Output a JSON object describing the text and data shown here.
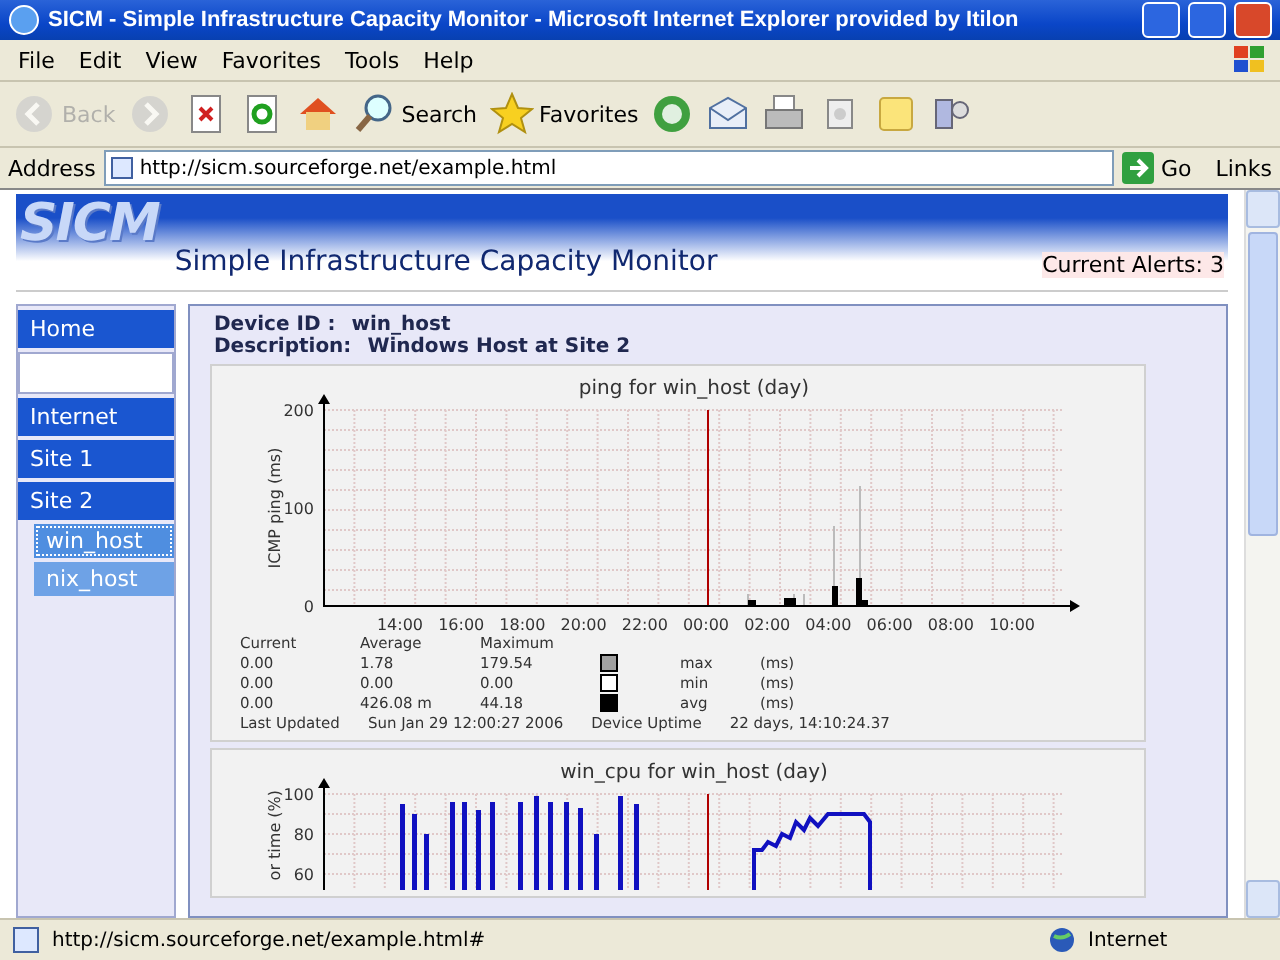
{
  "window": {
    "title": "SICM - Simple Infrastructure Capacity Monitor - Microsoft Internet Explorer provided by Itilon"
  },
  "menu": [
    "File",
    "Edit",
    "View",
    "Favorites",
    "Tools",
    "Help"
  ],
  "toolbar": [
    {
      "kind": "back",
      "label": "Back",
      "disabled": true
    },
    {
      "kind": "forward",
      "disabled": true
    },
    {
      "kind": "stop"
    },
    {
      "kind": "refresh"
    },
    {
      "kind": "home"
    },
    {
      "kind": "search",
      "label": "Search"
    },
    {
      "kind": "favorites",
      "label": "Favorites"
    },
    {
      "kind": "media"
    },
    {
      "kind": "mail"
    },
    {
      "kind": "print"
    },
    {
      "kind": "edit"
    },
    {
      "kind": "note"
    },
    {
      "kind": "messenger"
    }
  ],
  "address": {
    "label": "Address",
    "value": "http://sicm.sourceforge.net/example.html",
    "go": "Go",
    "links": "Links"
  },
  "header": {
    "logo": "SICM",
    "title": "Simple Infrastructure Capacity Monitor",
    "alerts": "Current Alerts: 3"
  },
  "sidebar": {
    "items": [
      {
        "kind": "link",
        "label": "Home",
        "selected": false
      },
      {
        "kind": "blank"
      },
      {
        "kind": "link",
        "label": "Internet",
        "selected": false
      },
      {
        "kind": "link",
        "label": "Site 1",
        "selected": false
      },
      {
        "kind": "link",
        "label": "Site 2",
        "selected": false,
        "children": [
          {
            "label": "win_host",
            "selected": true
          },
          {
            "label": "nix_host",
            "selected": false
          }
        ]
      }
    ]
  },
  "device": {
    "id_label": "Device ID :",
    "id": "win_host",
    "desc_label": "Description:",
    "desc": "Windows Host at Site 2"
  },
  "graphs": [
    {
      "kind": "ping",
      "title": "ping for win_host (day)",
      "ylabel": "ICMP ping (ms)",
      "yticks": [
        "200",
        "100",
        "0"
      ],
      "xticks": [
        "14:00",
        "16:00",
        "18:00",
        "20:00",
        "22:00",
        "00:00",
        "02:00",
        "04:00",
        "06:00",
        "08:00",
        "10:00"
      ],
      "legend_head": [
        "Current",
        "Average",
        "Maximum"
      ],
      "legend": [
        {
          "cur": "0.00",
          "avg": "1.78",
          "max": "179.54",
          "color": "#a0a0a0",
          "name": "max",
          "unit": "(ms)"
        },
        {
          "cur": "0.00",
          "avg": "0.00",
          "max": "0.00",
          "color": "#ffffff",
          "name": "min",
          "unit": "(ms)"
        },
        {
          "cur": "0.00",
          "avg": "426.08 m",
          "max": "44.18",
          "color": "#000000",
          "name": "avg",
          "unit": "(ms)"
        }
      ],
      "updated_label": "Last Updated",
      "updated": "Sun Jan 29 12:00:27 2006",
      "uptime_label": "Device Uptime",
      "uptime": "22 days, 14:10:24.37"
    },
    {
      "kind": "cpu",
      "title": "win_cpu for win_host (day)",
      "ylabel": "or time (%)",
      "yticks": [
        "100",
        "80",
        "60"
      ]
    }
  ],
  "status_bar": {
    "text": "http://sicm.sourceforge.net/example.html#",
    "zone": "Internet"
  }
}
